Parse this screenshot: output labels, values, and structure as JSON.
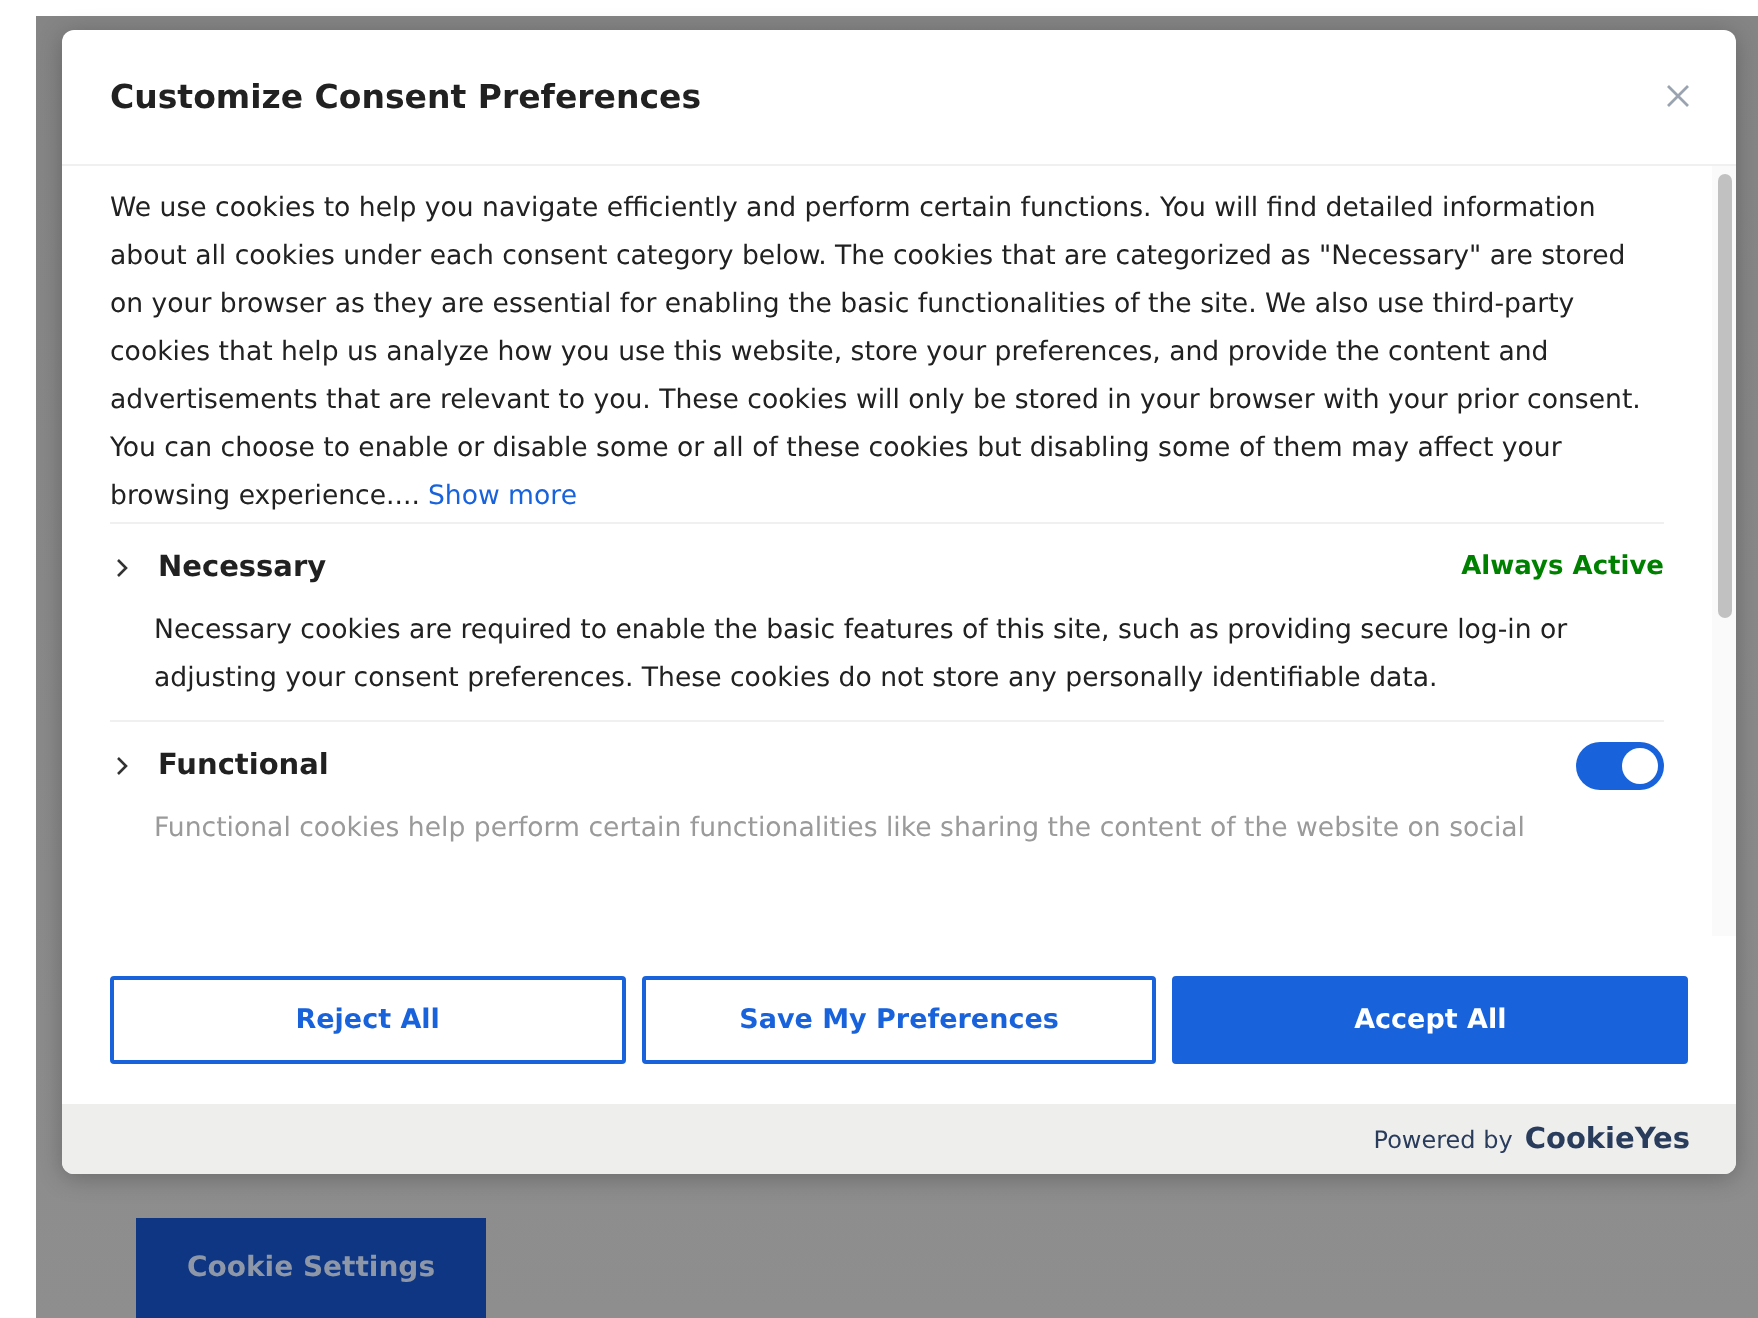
{
  "page": {
    "button": "Cookie Settings"
  },
  "dialog": {
    "title": "Customize Consent Preferences",
    "intro": "We use cookies to help you navigate efficiently and perform certain functions. You will find detailed information about all cookies under each consent category below. The cookies that are categorized as \"Necessary\" are stored on your browser as they are essential for enabling the basic functionalities of the site. We also use third-party cookies that help us analyze how you use this website, store your preferences, and provide the content and advertisements that are relevant to you. These cookies will only be stored in your browser with your prior consent. You can choose to enable or disable some or all of these cookies but disabling some of them may affect your browsing experience....",
    "show_more": "Show more",
    "categories": [
      {
        "kind": "status",
        "name": "Necessary",
        "status": "Always Active",
        "description": "Necessary cookies are required to enable the basic features of this site, such as providing secure log-in or adjusting your consent preferences. These cookies do not store any personally identifiable data."
      },
      {
        "kind": "toggle",
        "name": "Functional",
        "on": true,
        "description": "Functional cookies help perform certain functionalities like sharing the content of the website on social"
      }
    ],
    "buttons": [
      {
        "kind": "outline",
        "label": "Reject All"
      },
      {
        "kind": "outline",
        "label": "Save My Preferences"
      },
      {
        "kind": "primary",
        "label": "Accept All"
      }
    ],
    "footer": {
      "powered_by": "Powered by",
      "brand": "CookieYes"
    }
  }
}
